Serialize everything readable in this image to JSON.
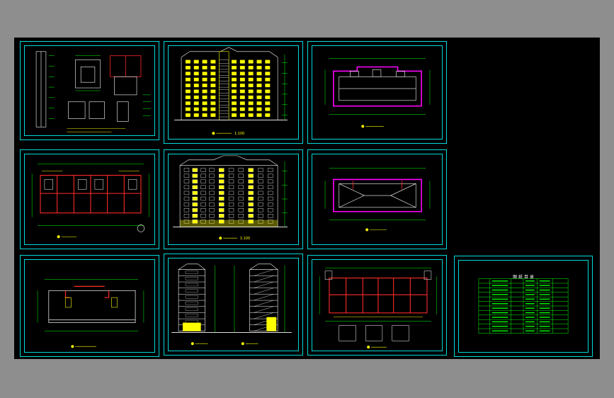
{
  "scale_labels": {
    "front_elevation": "1:100",
    "rear_elevation": "1:100"
  },
  "schedule": {
    "header": "图 纸 目 录"
  },
  "colors": {
    "frame": "#00d9d9",
    "line_green": "#00ff00",
    "line_yellow": "#ffff00",
    "line_red": "#ff2a2a",
    "line_magenta": "#ff00ff",
    "line_white": "#ffffff",
    "background": "#000000",
    "chrome": "#8e8e8e"
  }
}
